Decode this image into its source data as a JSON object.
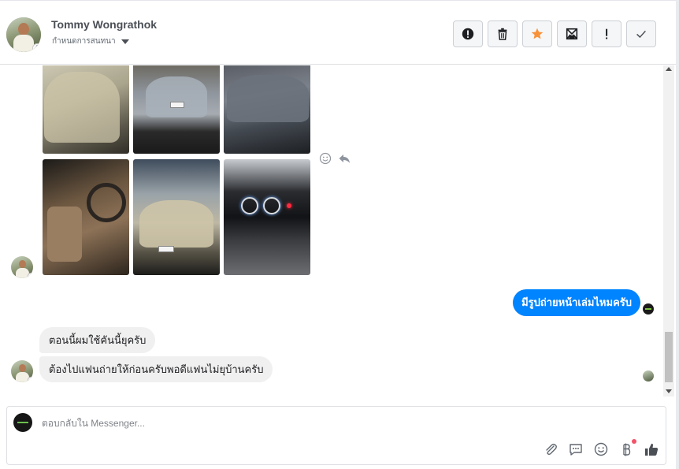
{
  "contact": {
    "name": "Tommy Wongrathok",
    "subtitle": "กำหนดการสนทนา"
  },
  "toolbar": {
    "buttons": [
      {
        "icon": "alert-circle-icon"
      },
      {
        "icon": "trash-icon"
      },
      {
        "icon": "star-icon",
        "color": "#f7923a"
      },
      {
        "icon": "mark-unread-icon"
      },
      {
        "icon": "report-exclamation-icon"
      },
      {
        "icon": "checkmark-icon"
      }
    ]
  },
  "thread": {
    "photos_count": 6,
    "outgoing_message": "มีรูปถ่ายหน้าเล่มไหมครับ",
    "incoming_messages": [
      "ตอนนี้ผมใช้คันนี้ยุครับ",
      "ต้องไปแฟนถ่ายให้ก่อนครับพอดีแฟนไม่ยุบ้านครับ"
    ]
  },
  "composer": {
    "placeholder": "ตอบกลับใน Messenger..."
  },
  "colors": {
    "brand_blue": "#0084ff",
    "incoming_bubble": "#f1f0f0",
    "star_orange": "#f7923a"
  }
}
